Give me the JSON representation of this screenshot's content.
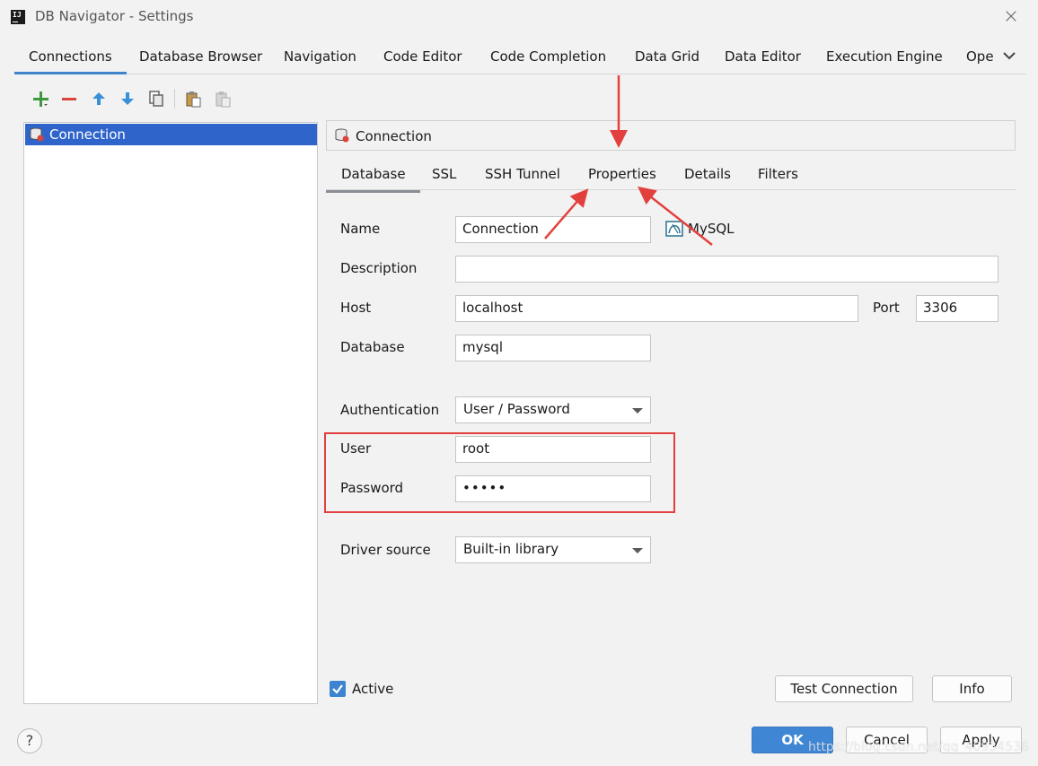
{
  "window": {
    "title": "DB Navigator - Settings",
    "app_icon_text": "IJ",
    "close_icon": "close-icon"
  },
  "main_tabs": [
    {
      "label": "Connections",
      "active": true
    },
    {
      "label": "Database Browser"
    },
    {
      "label": "Navigation"
    },
    {
      "label": "Code Editor"
    },
    {
      "label": "Code Completion"
    },
    {
      "label": "Data Grid"
    },
    {
      "label": "Data Editor"
    },
    {
      "label": "Execution Engine"
    },
    {
      "label": "Ope"
    }
  ],
  "toolbar": {
    "add_icon": "plus-icon",
    "remove_icon": "minus-icon",
    "move_up_icon": "arrow-up-icon",
    "move_down_icon": "arrow-down-icon",
    "copy_icon": "copy-icon",
    "paste_icon": "paste-icon",
    "paste_disabled_icon": "paste-disabled-icon"
  },
  "connections_list": [
    {
      "label": "Connection",
      "selected": true
    }
  ],
  "detail": {
    "header_label": "Connection",
    "sub_tabs": [
      {
        "label": "Database",
        "active": true
      },
      {
        "label": "SSL"
      },
      {
        "label": "SSH Tunnel"
      },
      {
        "label": "Properties"
      },
      {
        "label": "Details"
      },
      {
        "label": "Filters"
      }
    ],
    "form": {
      "name_label": "Name",
      "name_value": "Connection",
      "db_type": "MySQL",
      "description_label": "Description",
      "description_value": "",
      "host_label": "Host",
      "host_value": "localhost",
      "port_label": "Port",
      "port_value": "3306",
      "database_label": "Database",
      "database_value": "mysql",
      "auth_label": "Authentication",
      "auth_value": "User / Password",
      "user_label": "User",
      "user_value": "root",
      "password_label": "Password",
      "password_value": "•••••",
      "driver_label": "Driver source",
      "driver_value": "Built-in library"
    },
    "active_label": "Active",
    "active_checked": true,
    "test_connection_label": "Test Connection",
    "info_label": "Info"
  },
  "footer": {
    "help_label": "?",
    "ok_label": "OK",
    "cancel_label": "Cancel",
    "apply_label": "Apply"
  },
  "watermark": "https://blog.csdn.net/qq_40934536",
  "colors": {
    "accent": "#4083c9",
    "selection": "#2f65ca",
    "annotation_red": "#e2403e",
    "primary_button": "#3f86d5"
  }
}
